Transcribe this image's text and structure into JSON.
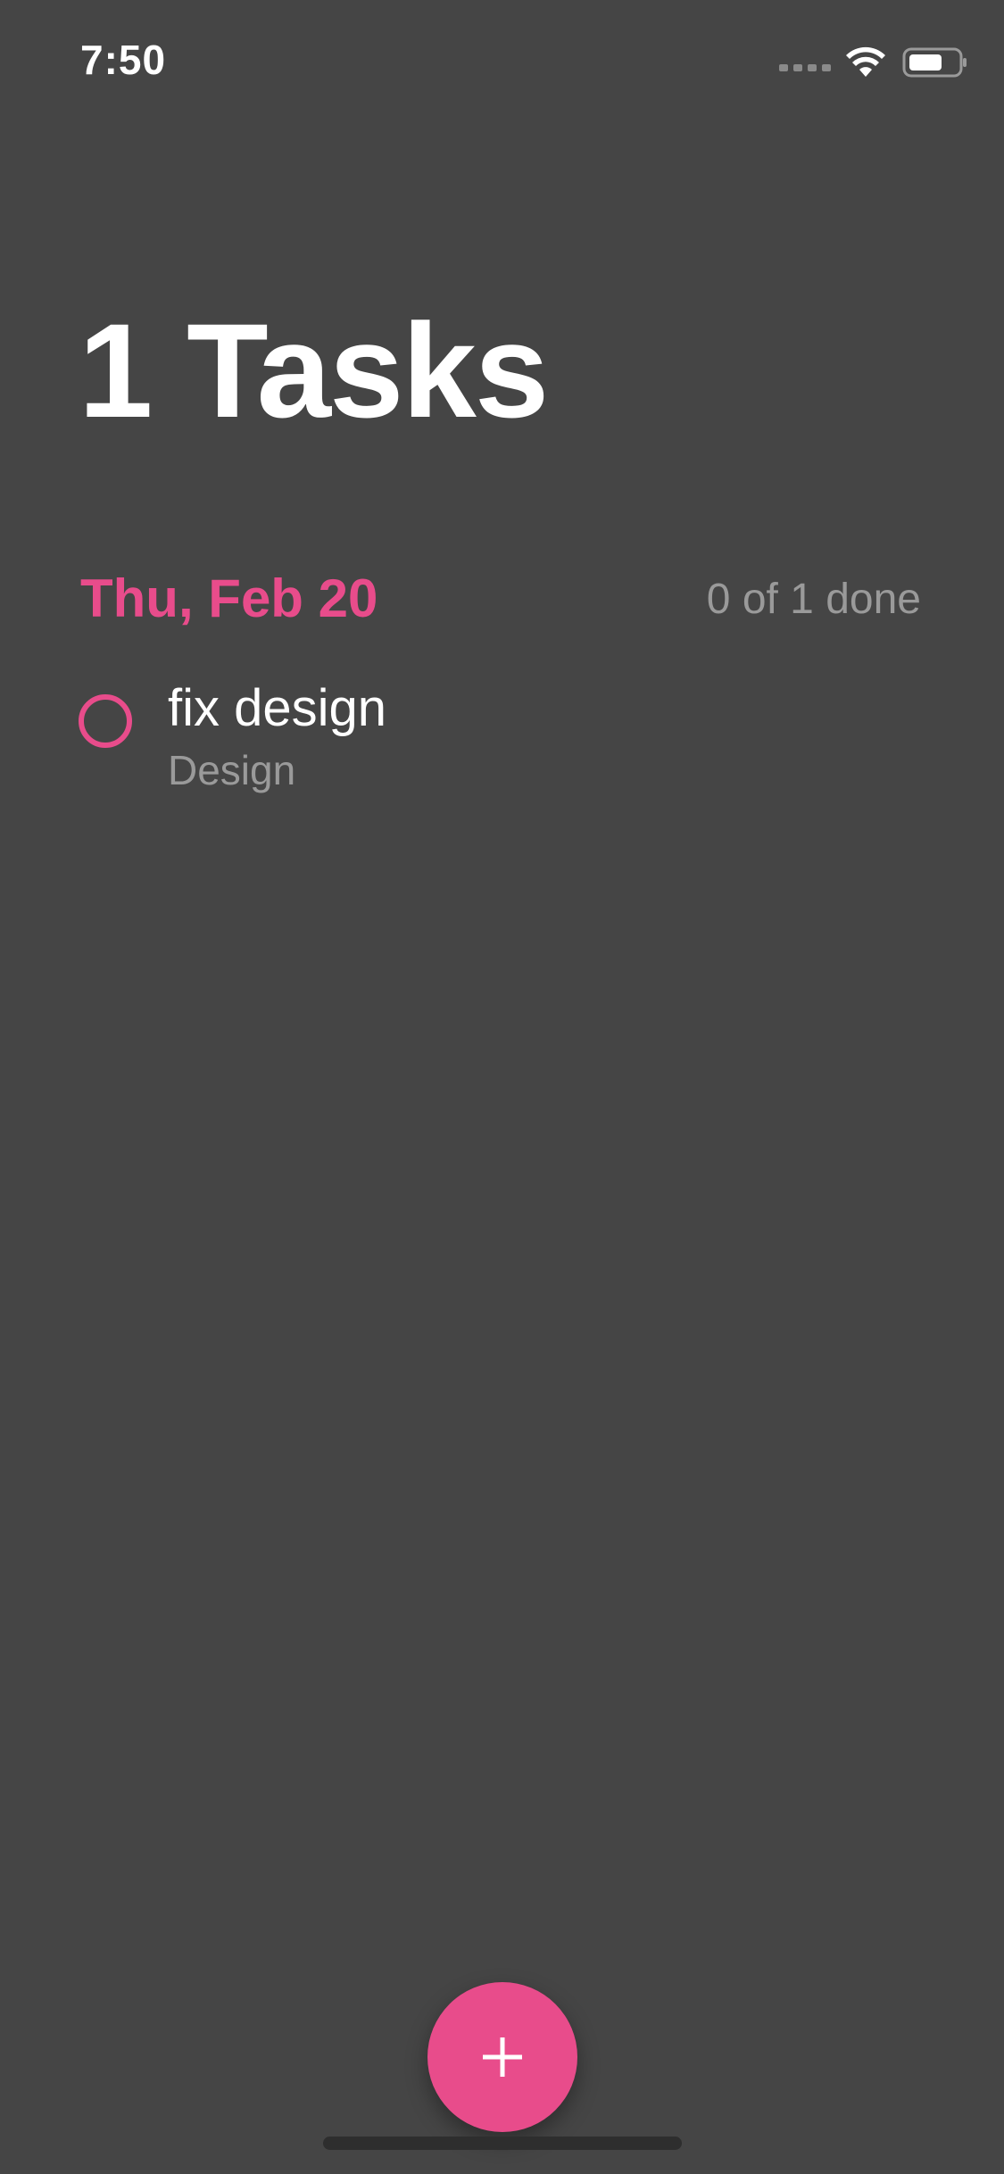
{
  "status_bar": {
    "time": "7:50"
  },
  "header": {
    "title": "1 Tasks"
  },
  "section": {
    "date": "Thu, Feb 20",
    "progress": "0 of 1 done"
  },
  "tasks": [
    {
      "title": "fix design",
      "category": "Design",
      "done": false
    }
  ],
  "icons": {
    "checkbox": "circle-outline-icon",
    "fab": "plus-icon",
    "wifi": "wifi-icon",
    "battery": "battery-icon",
    "signal": "signal-icon"
  },
  "colors": {
    "background": "#454545",
    "accent": "#e84c8b",
    "secondary_text": "#9a9a9a",
    "primary_text": "#ffffff"
  }
}
